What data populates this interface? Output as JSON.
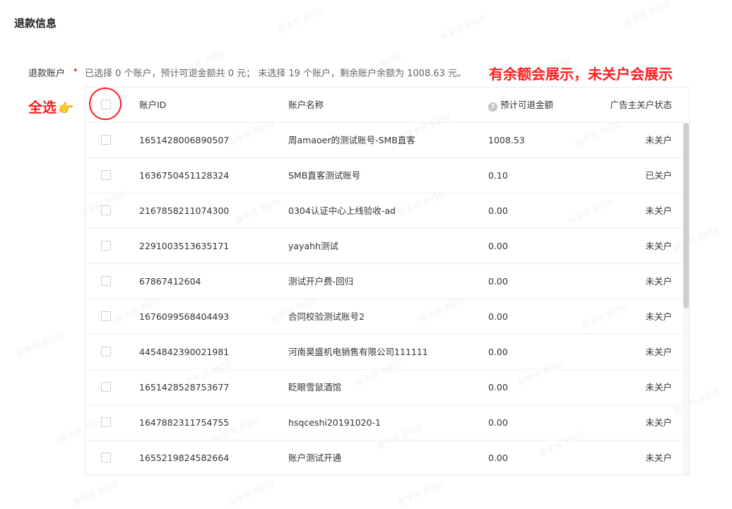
{
  "section": {
    "title": "退款信息"
  },
  "refund_accounts": {
    "label": "退款账户",
    "required_mark": "•",
    "summary": "已选择 0 个账户，预计可退金额共 0 元； 未选择 19 个账户，剩余账户余额为 1008.63 元。"
  },
  "annotations": {
    "right_note": "有余额会展示，未关户会展示",
    "select_all": "全选",
    "hand": "👉"
  },
  "table": {
    "columns": {
      "account_id": "账户ID",
      "account_name": "账户名称",
      "estimated_refund": "预计可退金额",
      "help_glyph": "?",
      "status": "广告主关户状态"
    },
    "rows": [
      {
        "id": "1651428006890507",
        "name": "周amaoer的测试账号-SMB直客",
        "amount": "1008.53",
        "status": "未关户"
      },
      {
        "id": "1636750451128324",
        "name": "SMB直客测试账号",
        "amount": "0.10",
        "status": "已关户"
      },
      {
        "id": "2167858211074300",
        "name": "0304认证中心上线验收-ad",
        "amount": "0.00",
        "status": "未关户"
      },
      {
        "id": "2291003513635171",
        "name": "yayahh测试",
        "amount": "0.00",
        "status": "未关户"
      },
      {
        "id": "67867412604",
        "name": "测试开户费-回归",
        "amount": "0.00",
        "status": "未关户"
      },
      {
        "id": "1676099568404493",
        "name": "合同校验测试账号2",
        "amount": "0.00",
        "status": "未关户"
      },
      {
        "id": "4454842390021981",
        "name": "河南昊盛机电销售有限公司111111",
        "amount": "0.00",
        "status": "未关户"
      },
      {
        "id": "1651428528753677",
        "name": "眨眼雪鼠酒馆",
        "amount": "0.00",
        "status": "未关户"
      },
      {
        "id": "1647882311754755",
        "name": "hsqceshi20191020-1",
        "amount": "0.00",
        "status": "未关户"
      },
      {
        "id": "1655219824582664",
        "name": "账户测试开通",
        "amount": "0.00",
        "status": "未关户"
      }
    ]
  },
  "watermark": {
    "text": "周宇月 8950"
  },
  "colors": {
    "annotation": "#ff1e1e",
    "required": "#e0312f",
    "border": "#ebebeb"
  }
}
